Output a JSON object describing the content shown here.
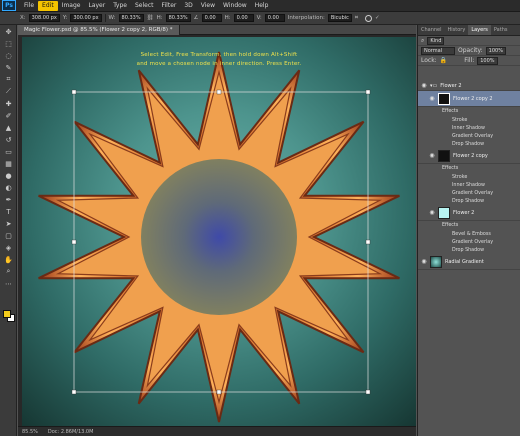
{
  "app": {
    "logo": "Ps"
  },
  "menu": [
    "File",
    "Edit",
    "Image",
    "Layer",
    "Type",
    "Select",
    "Filter",
    "3D",
    "View",
    "Window",
    "Help"
  ],
  "options": {
    "x_label": "X:",
    "x_value": "308.00 px",
    "y_label": "Y:",
    "y_value": "300.00 px",
    "w_label": "W:",
    "w_value": "80.33%",
    "h_label": "H:",
    "h_value": "80.33%",
    "angle_value": "0.00",
    "hskew_label": "H:",
    "hskew_value": "0.00",
    "vskew_label": "V:",
    "vskew_value": "0.00",
    "interp_label": "Interpolation:",
    "interp_value": "Bicubic"
  },
  "document": {
    "tab_title": "Magic Flower.psd @ 85.5% (Flower 2  copy 2, RGB/8) *",
    "instruction_line1": "Select Edit, Free Transform, then hold down Alt+Shift",
    "instruction_line2": "and move a chosen node in inner direction. Press Enter.",
    "zoom": "85.5%",
    "doc_size": "Doc: 2.86M/13.0M"
  },
  "panel": {
    "tabs": [
      "Channel",
      "History",
      "Layers",
      "Paths"
    ],
    "active_tab": "Layers",
    "kind": "Kind",
    "blend_mode": "Normal",
    "opacity_label": "Opacity:",
    "opacity_value": "100%",
    "lock_label": "Lock:",
    "fill_label": "Fill:",
    "fill_value": "100%",
    "group_name": "Flower 2",
    "layers": [
      {
        "name": "Flower 2  copy 2",
        "effects_label": "Effects",
        "effects": [
          "Stroke",
          "Inner Shadow",
          "Gradient Overlay",
          "Drop Shadow"
        ]
      },
      {
        "name": "Flower 2  copy",
        "effects_label": "Effects",
        "effects": [
          "Stroke",
          "Inner Shadow",
          "Gradient Overlay",
          "Drop Shadow"
        ]
      },
      {
        "name": "Flower 2",
        "effects_label": "Effects",
        "effects": [
          "Bevel & Emboss",
          "Gradient Overlay",
          "Drop Shadow"
        ]
      }
    ],
    "bottom_layer": "Radial Gradient"
  },
  "colors": {
    "accent": "#f5c400",
    "selected_layer": "#6f81a0",
    "instruction": "#f2e44b"
  }
}
